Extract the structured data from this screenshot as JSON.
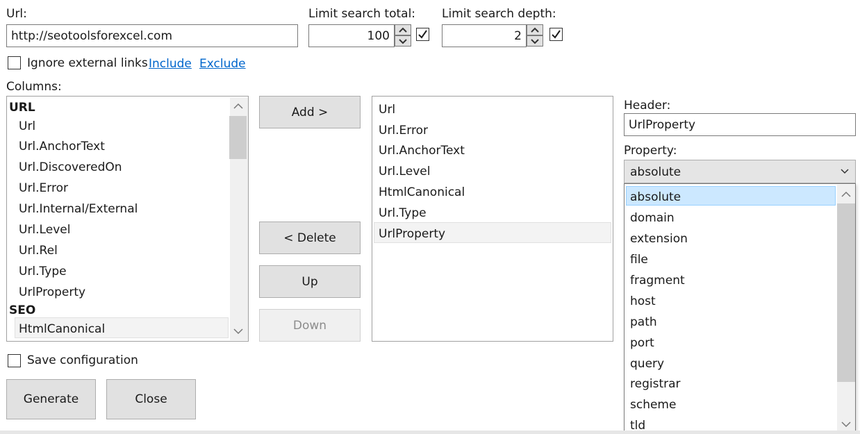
{
  "url": {
    "label": "Url:",
    "value": "http://seotoolsforexcel.com"
  },
  "limit_total": {
    "label": "Limit search total:",
    "value": "100",
    "checked": true
  },
  "limit_depth": {
    "label": "Limit search depth:",
    "value": "2",
    "checked": true
  },
  "ignore_external": {
    "label": "Ignore external links",
    "checked": false
  },
  "links": {
    "include": "Include",
    "exclude": "Exclude"
  },
  "columns": {
    "label": "Columns:",
    "groups": [
      {
        "name": "URL",
        "items": [
          "Url",
          "Url.AnchorText",
          "Url.DiscoveredOn",
          "Url.Error",
          "Url.Internal/External",
          "Url.Level",
          "Url.Rel",
          "Url.Type",
          "UrlProperty"
        ]
      },
      {
        "name": "SEO",
        "items": [
          "HtmlCanonical"
        ]
      }
    ]
  },
  "buttons": {
    "add": "Add >",
    "delete": "< Delete",
    "up": "Up",
    "down": "Down",
    "generate": "Generate",
    "close": "Close"
  },
  "selected_columns": [
    "Url",
    "Url.Error",
    "Url.AnchorText",
    "Url.Level",
    "HtmlCanonical",
    "Url.Type",
    "UrlProperty"
  ],
  "header": {
    "label": "Header:",
    "value": "UrlProperty"
  },
  "property": {
    "label": "Property:",
    "value": "absolute",
    "options": [
      "absolute",
      "domain",
      "extension",
      "file",
      "fragment",
      "host",
      "path",
      "port",
      "query",
      "registrar",
      "scheme",
      "tld"
    ]
  },
  "save_configuration": {
    "label": "Save configuration",
    "checked": false
  },
  "colors": {
    "link": "#0066cc",
    "selection": "#cce8ff",
    "button_face": "#e1e1e1"
  }
}
